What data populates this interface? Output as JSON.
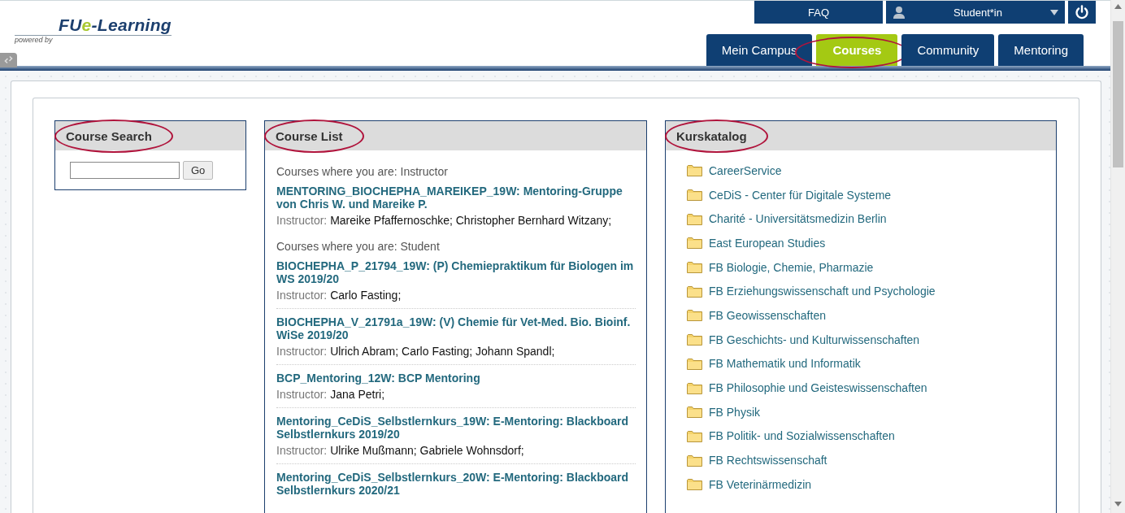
{
  "header": {
    "logo": {
      "prefix": "FU",
      "accent": "e",
      "suffix": "-Learning",
      "tagline": "powered by"
    },
    "top_links": [
      {
        "label": "FAQ"
      }
    ],
    "user_menu": {
      "label": "Student*in"
    },
    "tabs": [
      {
        "label": "Mein Campus",
        "selected": false,
        "circled": false
      },
      {
        "label": "Courses",
        "selected": true,
        "circled": true
      },
      {
        "label": "Community",
        "selected": false,
        "circled": false
      },
      {
        "label": "Mentoring",
        "selected": false,
        "circled": false
      }
    ]
  },
  "course_search": {
    "title": "Course Search",
    "circled": true,
    "button": "Go"
  },
  "course_list": {
    "title": "Course List",
    "circled": true,
    "groups": [
      {
        "heading": "Courses where you are: Instructor",
        "courses": [
          {
            "title": "MENTORING_BIOCHEPHA_MAREIKEP_19W: Mentoring-Gruppe von Chris W. und Mareike P.",
            "role_label": "Instructor:",
            "names": "Mareike Pfaffernoschke;  Christopher Bernhard Witzany;"
          }
        ]
      },
      {
        "heading": "Courses where you are: Student",
        "courses": [
          {
            "title": "BIOCHEPHA_P_21794_19W: (P) Chemiepraktikum für Biologen im WS 2019/20",
            "role_label": "Instructor:",
            "names": "Carlo Fasting;"
          },
          {
            "title": "BIOCHEPHA_V_21791a_19W: (V) Chemie für Vet-Med. Bio. Bioinf. WiSe 2019/20",
            "role_label": "Instructor:",
            "names": "Ulrich Abram;  Carlo Fasting;  Johann Spandl;"
          },
          {
            "title": "BCP_Mentoring_12W: BCP Mentoring",
            "role_label": "Instructor:",
            "names": "Jana Petri;"
          },
          {
            "title": "Mentoring_CeDiS_Selbstlernkurs_19W: E-Mentoring: Blackboard Selbstlernkurs 2019/20",
            "role_label": "Instructor:",
            "names": "Ulrike Mußmann;  Gabriele Wohnsdorf;"
          },
          {
            "title": "Mentoring_CeDiS_Selbstlernkurs_20W: E-Mentoring: Blackboard Selbstlernkurs 2020/21"
          }
        ]
      }
    ]
  },
  "catalog": {
    "title": "Kurskatalog",
    "circled": true,
    "items": [
      "CareerService",
      "CeDiS - Center für Digitale Systeme",
      "Charité - Universitätsmedizin Berlin",
      "East European Studies",
      "FB Biologie, Chemie, Pharmazie",
      "FB Erziehungswissenschaft und Psychologie",
      "FB Geowissenschaften",
      "FB Geschichts- und Kulturwissenschaften",
      "FB Mathematik und Informatik",
      "FB Philosophie und Geisteswissenschaften",
      "FB Physik",
      "FB Politik- und Sozialwissenschaften",
      "FB Rechtswissenschaft",
      "FB Veterinärmedizin"
    ]
  }
}
